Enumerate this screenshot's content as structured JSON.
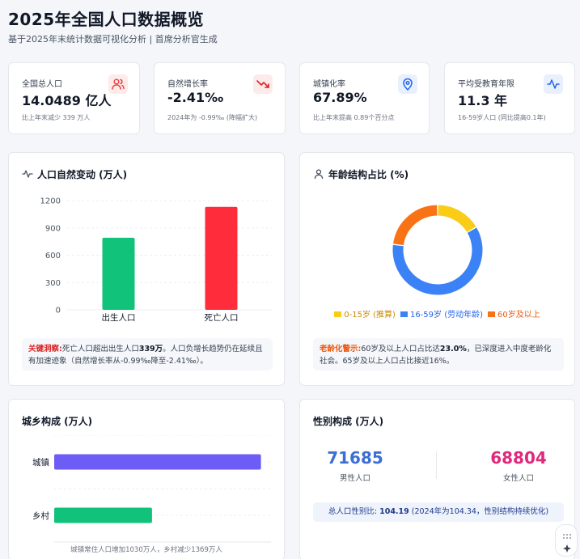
{
  "page": {
    "title": "2025年全国人口数据概览",
    "subtitle": "基于2025年末统计数据可视化分析 | 首席分析官生成"
  },
  "stats": [
    {
      "label": "全国总人口",
      "value": "14.0489 亿人",
      "note": "比上年末减少 339 万人",
      "icon": "users-icon",
      "color": "#ef4444"
    },
    {
      "label": "自然增长率",
      "value": "-2.41‰",
      "note": "2024年为 -0.99‰ (降幅扩大)",
      "icon": "trend-down-icon",
      "color": "#dc2626"
    },
    {
      "label": "城镇化率",
      "value": "67.89%",
      "note": "比上年末提高 0.89个百分点",
      "icon": "map-pin-icon",
      "color": "#2563eb"
    },
    {
      "label": "平均受教育年限",
      "value": "11.3 年",
      "note": "16-59岁人口 (同比提高0.1年)",
      "icon": "activity-icon",
      "color": "#2563eb"
    }
  ],
  "natural_change": {
    "title": "人口自然变动 (万人)",
    "insight_label": "关键洞察:",
    "insight_pre": "死亡人口超出出生人口",
    "insight_value": "339万",
    "insight_post": "。人口负增长趋势仍在延续且有加速迹象（自然增长率从-0.99‰降至-2.41‰）。"
  },
  "age_structure": {
    "title": "年龄结构占比 (%)",
    "insight_label": "老龄化警示:",
    "insight_pre": "60岁及以上人口占比达",
    "insight_value": "23.0%",
    "insight_post": "，已深度进入中度老龄化社会。65岁及以上人口占比接近16%。"
  },
  "urban_rural": {
    "title": "城乡构成 (万人)",
    "footnote": "城镇常住人口增加1030万人，乡村减少1369万人"
  },
  "gender": {
    "title": "性别构成 (万人)",
    "male_value": "71685",
    "male_label": "男性人口",
    "male_color": "#3b6fd4",
    "female_value": "68804",
    "female_label": "女性人口",
    "female_color": "#e0287d",
    "ratio_label": "总人口性别比:",
    "ratio_value": "104.19",
    "ratio_note": "(2024年为104.34，性别结构持续优化)"
  },
  "chart_data": [
    {
      "type": "bar",
      "categories": [
        "出生人口",
        "死亡人口"
      ],
      "values": [
        792,
        1131
      ],
      "colors": [
        "#10c27a",
        "#ff2d3b"
      ],
      "ylim": [
        0,
        1200
      ],
      "yticks": [
        0,
        300,
        600,
        900,
        1200
      ],
      "grid": true
    },
    {
      "type": "pie",
      "donut": true,
      "labels": [
        "0-15岁 (推算)",
        "16-59岁 (劳动年龄)",
        "60岁及以上"
      ],
      "values": [
        16.5,
        60.5,
        23.0
      ],
      "colors": [
        "#facc15",
        "#3b82f6",
        "#f97316"
      ],
      "legend": "bottom"
    },
    {
      "type": "bar",
      "orientation": "horizontal",
      "categories": [
        "城镇",
        "乡村"
      ],
      "values": [
        95380,
        45109
      ],
      "colors": [
        "#6d5cf5",
        "#10c27a"
      ],
      "xlim": [
        0,
        100000
      ],
      "grid": true
    }
  ]
}
